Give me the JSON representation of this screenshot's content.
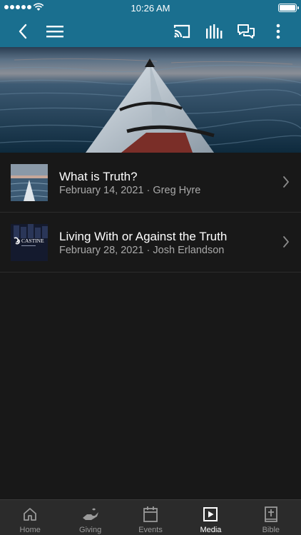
{
  "status_bar": {
    "time": "10:26 AM",
    "signal_dots": 5,
    "battery_level": 1.0
  },
  "nav": {
    "back_icon": "chevron-left-icon",
    "menu_icon": "hamburger-menu-icon",
    "actions": [
      "cast-icon",
      "audio-bars-icon",
      "chat-icon",
      "more-vertical-icon"
    ]
  },
  "hero_image": "kayak-bow-on-water",
  "items": [
    {
      "title": "What is Truth?",
      "date": "February 14, 2021",
      "separator": "·",
      "speaker": "Greg Hyre",
      "thumb": "kayak-thumbnail"
    },
    {
      "title": "Living With or Against the Truth",
      "date": "February 28, 2021",
      "separator": "·",
      "speaker": "Josh Erlandson",
      "thumb": "castine-logo-thumbnail",
      "thumb_text": "CASTINE"
    }
  ],
  "tabs": [
    {
      "label": "Home",
      "icon": "home-icon",
      "active": false
    },
    {
      "label": "Giving",
      "icon": "giving-hand-icon",
      "active": false
    },
    {
      "label": "Events",
      "icon": "calendar-icon",
      "active": false
    },
    {
      "label": "Media",
      "icon": "play-square-icon",
      "active": true
    },
    {
      "label": "Bible",
      "icon": "bible-icon",
      "active": false
    }
  ],
  "colors": {
    "header": "#1a6f8f",
    "background": "#181818",
    "tabbar": "#2b2b2b",
    "secondary_text": "#a9a9a9"
  }
}
